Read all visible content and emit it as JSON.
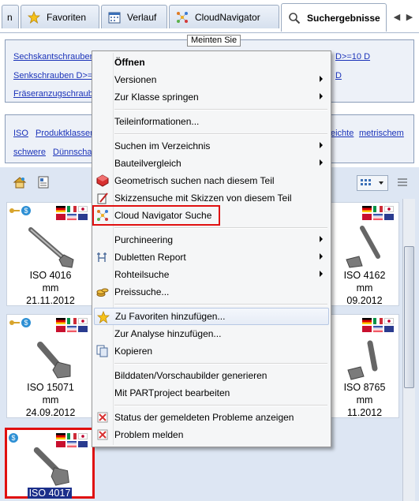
{
  "tabs": [
    {
      "label": "n",
      "icon": "partial-tab-icon"
    },
    {
      "label": "Favoriten",
      "icon": "star-icon"
    },
    {
      "label": "Verlauf",
      "icon": "calendar-icon"
    },
    {
      "label": "CloudNavigator",
      "icon": "cloud-network-icon"
    },
    {
      "label": "Suchergebnisse",
      "icon": "search-icon",
      "active": true
    }
  ],
  "meinten_sie": {
    "label": "Meinten Sie",
    "links": [
      "Sechskantschrauben",
      "D>=10 D",
      "Senkschrauben D>=",
      "D",
      "Fräseranzugschraube"
    ]
  },
  "suggestions": {
    "links": [
      "ISO",
      "Produktklassen",
      "eichte",
      "metrischem",
      "schwere",
      "Dünnschaf"
    ]
  },
  "cards": [
    {
      "name": "ISO 4016",
      "unit": "mm",
      "date": "21.11.2012"
    },
    {
      "name": "ISO 4162",
      "unit": "mm",
      "date": "09.2012"
    },
    {
      "name": "ISO 15071",
      "unit": "mm",
      "date": "24.09.2012"
    },
    {
      "name": "ISO 8765",
      "unit": "mm",
      "date": "11.2012"
    },
    {
      "name": "ISO 4017",
      "selected": true
    }
  ],
  "menu": {
    "items": [
      {
        "label": "Öffnen",
        "bold": true
      },
      {
        "label": "Versionen",
        "submenu": true
      },
      {
        "label": "Zur Klasse springen",
        "submenu": true
      },
      {
        "label": "Teileinformationen..."
      },
      {
        "label": "Suchen im Verzeichnis",
        "submenu": true
      },
      {
        "label": "Bauteilvergleich",
        "submenu": true
      },
      {
        "label": "Geometrisch suchen nach diesem Teil",
        "icon": "geometric-search-icon"
      },
      {
        "label": "Skizzensuche mit Skizzen von diesem Teil",
        "icon": "sketch-search-icon"
      },
      {
        "label": "Cloud Navigator Suche",
        "icon": "cloud-navigator-icon",
        "highlighted": true
      },
      {
        "label": "Purchineering",
        "submenu": true
      },
      {
        "label": "Dubletten Report",
        "icon": "duplicates-icon",
        "submenu": true
      },
      {
        "label": "Rohteilsuche",
        "submenu": true
      },
      {
        "label": "Preissuche...",
        "icon": "coins-icon"
      },
      {
        "label": "Zu Favoriten hinzufügen...",
        "icon": "star-icon",
        "hover": true
      },
      {
        "label": "Zur Analyse hinzufügen..."
      },
      {
        "label": "Kopieren",
        "icon": "copy-icon"
      },
      {
        "label": "Bilddaten/Vorschaubilder generieren"
      },
      {
        "label": "Mit PARTproject bearbeiten"
      },
      {
        "label": "Status der gemeldeten Probleme anzeigen",
        "icon": "report-status-icon"
      },
      {
        "label": "Problem melden",
        "icon": "report-problem-icon"
      }
    ]
  },
  "colors": {
    "link": "#1b33b9",
    "highlight_box": "#e01010",
    "selected_label_bg": "#1b2f8a",
    "panel_bg": "#edf1f8"
  }
}
